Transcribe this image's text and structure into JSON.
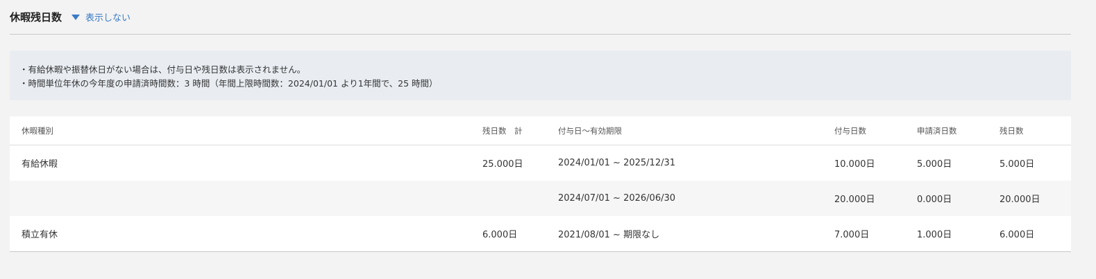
{
  "section": {
    "title": "休暇残日数",
    "toggle_label": "表示しない",
    "toggle_icon": "caret-down-icon",
    "accent_color": "#3b7bc8"
  },
  "notice": {
    "lines": [
      "・有給休暇や振替休日がない場合は、付与日や残日数は表示されません。",
      "・時間単位年休の今年度の申請済時間数：3 時間（年間上限時間数：2024/01/01 より1年間で、25 時間）"
    ]
  },
  "table": {
    "headers": [
      "休暇種別",
      "残日数　計",
      "付与日〜有効期限",
      "付与日数",
      "申請済日数",
      "残日数"
    ],
    "rows": [
      [
        "有給休暇",
        "25.000日",
        "2024/01/01 ~ 2025/12/31",
        "10.000日",
        "5.000日",
        "5.000日"
      ],
      [
        "",
        "",
        "2024/07/01 ~ 2026/06/30",
        "20.000日",
        "0.000日",
        "20.000日"
      ],
      [
        "積立有休",
        "6.000日",
        "2021/08/01 ~ 期限なし",
        "7.000日",
        "1.000日",
        "6.000日"
      ]
    ]
  }
}
